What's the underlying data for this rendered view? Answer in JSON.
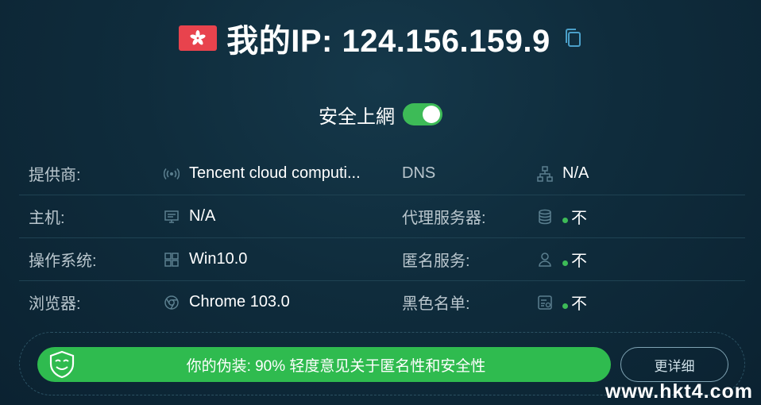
{
  "header": {
    "ip_label": "我的IP: 124.156.159.9"
  },
  "safe": {
    "label": "安全上網",
    "enabled": true
  },
  "rows": [
    {
      "left_label": "提供商:",
      "left_icon": "signal-icon",
      "left_value": "Tencent cloud computi...",
      "right_label": "DNS",
      "right_icon": "network-icon",
      "right_value": "N/A"
    },
    {
      "left_label": "主机:",
      "left_icon": "host-icon",
      "left_value": "N/A",
      "right_label": "代理服务器:",
      "right_icon": "database-icon",
      "right_value": "不"
    },
    {
      "left_label": "操作系统:",
      "left_icon": "windows-icon",
      "left_value": "Win10.0",
      "right_label": "匿名服务:",
      "right_icon": "user-icon",
      "right_value": "不"
    },
    {
      "left_label": "浏览器:",
      "left_icon": "chrome-icon",
      "left_value": "Chrome 103.0",
      "right_label": "黑色名单:",
      "right_icon": "blacklist-icon",
      "right_value": "不"
    }
  ],
  "disguise": {
    "text": "你的伪装: 90% 轻度意见关于匿名性和安全性",
    "percent": 90
  },
  "details_button": "更详细",
  "watermark": "www.hkt4.com",
  "colors": {
    "accent_green": "#2fbb4f",
    "flag_red": "#e8434d",
    "background": "#0f2c3c"
  }
}
